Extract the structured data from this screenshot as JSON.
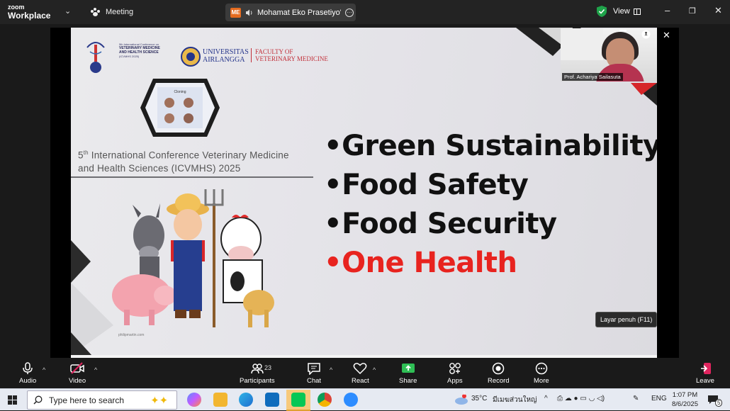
{
  "titlebar": {
    "brand_line1": "zoom",
    "brand_line2": "Workplace",
    "meeting_label": "Meeting",
    "share_badge": "ME",
    "share_tab_label": "Mohamat Eko Prasetiyo's scr",
    "view_label": "View",
    "colors": {
      "bg": "#232323",
      "badge": "#e56b1f",
      "shield": "#1fa34a"
    }
  },
  "slide": {
    "conference_mini": [
      "5th International Conference on",
      "VETERINARY MEDICINE",
      "AND HEALTH SCIENCE",
      "(ICVMHS 2025)"
    ],
    "university": [
      "UNIVERSITAS",
      "AIRLANGGA"
    ],
    "faculty": [
      "FACULTY OF",
      "VETERINARY MEDICINE"
    ],
    "hex_caption": "Cloning",
    "conference_title_prefix": "5",
    "conference_title_sup": "th",
    "conference_title_line1": " International Conference Veterinary Medicine",
    "conference_title_line2": "and Health Sciences (ICVMHS) 2025",
    "bullets": [
      {
        "text": "•Green Sustainability",
        "color": "#111111"
      },
      {
        "text": "•Food Safety",
        "color": "#111111"
      },
      {
        "text": "•Food Security",
        "color": "#111111"
      },
      {
        "text": "•One Health",
        "color": "#e8231f"
      }
    ],
    "credit": "philipmartin.com"
  },
  "fullscreen_tooltip": "Layar penuh (F11)",
  "presenter": {
    "name": "Prof. Achariya Sailasuta"
  },
  "toolbar": {
    "audio": "Audio",
    "video": "Video",
    "participants": "Participants",
    "participants_count": "23",
    "chat": "Chat",
    "react": "React",
    "share": "Share",
    "apps": "Apps",
    "record": "Record",
    "more": "More",
    "leave": "Leave",
    "colors": {
      "share": "#2fbf55",
      "leave": "#e0245e"
    }
  },
  "taskbar": {
    "search_placeholder": "Type here to search",
    "weather_badge": "1",
    "temperature": "35°C",
    "weather_text": "มีเมฆส่วนใหญ่",
    "language": "ENG",
    "time": "1:07 PM",
    "date": "8/6/2025",
    "notifications": "5"
  }
}
